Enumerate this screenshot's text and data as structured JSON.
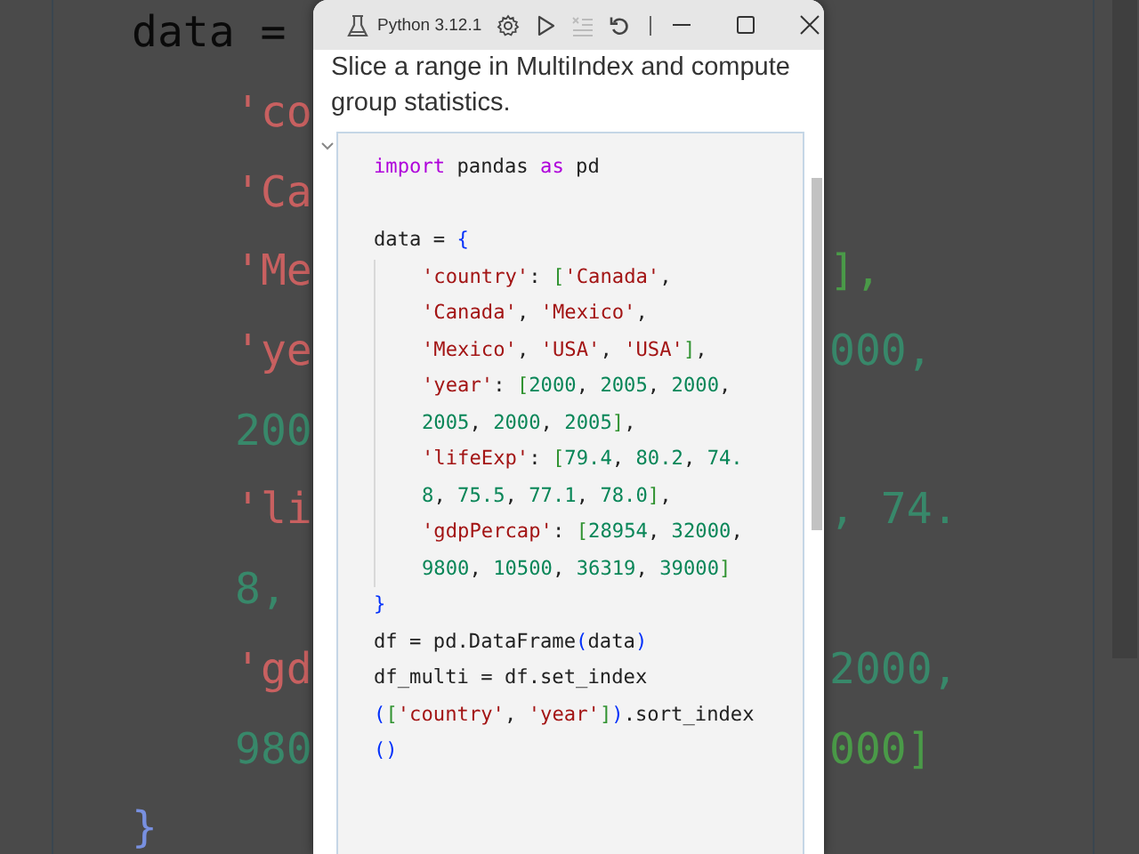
{
  "background_code": {
    "lines": [
      {
        "kind": "plain",
        "text": "data =",
        "children": [
          {
            "kind": "str",
            "text": "'co"
          },
          {
            "kind": "str",
            "text": "'Ca"
          },
          {
            "kind": "str",
            "text": "'Me",
            "right": {
              "kind": "bracket",
              "text": "],"
            }
          },
          {
            "kind": "str",
            "text": "'ye",
            "right": {
              "kind": "num",
              "text": "000,"
            }
          },
          {
            "kind": "num",
            "text": "200"
          },
          {
            "kind": "str",
            "text": "'li",
            "right": {
              "kind": "num",
              "text": ", 74."
            }
          },
          {
            "kind": "num",
            "text": "8,"
          },
          {
            "kind": "str",
            "text": "'gd",
            "right": {
              "kind": "num",
              "text": "2000,"
            }
          },
          {
            "kind": "num",
            "text": "980",
            "right": {
              "kind": "bracket",
              "text": "000]"
            }
          }
        ]
      },
      {
        "kind": "brace",
        "text": "}"
      }
    ]
  },
  "window": {
    "kernel": "Python 3.12.1",
    "toolbar": [
      {
        "kind": "settings",
        "disabled": false
      },
      {
        "kind": "run",
        "disabled": false
      },
      {
        "kind": "clear",
        "disabled": true
      },
      {
        "kind": "restart",
        "disabled": false
      }
    ],
    "description": "Slice a range in MultiIndex and compute group statistics.",
    "cell": {
      "expanded": true,
      "lines": [
        {
          "kind": "code",
          "tokens": [
            {
              "kind": "kw",
              "text": "import"
            },
            {
              "kind": "plain",
              "text": " pandas "
            },
            {
              "kind": "kw",
              "text": "as"
            },
            {
              "kind": "plain",
              "text": " pd"
            }
          ]
        },
        {
          "kind": "blank"
        },
        {
          "kind": "code",
          "tokens": [
            {
              "kind": "plain",
              "text": "data = "
            },
            {
              "kind": "brace",
              "text": "{"
            }
          ],
          "children": [
            {
              "kind": "code",
              "tokens": [
                {
                  "kind": "str",
                  "text": "'country'"
                },
                {
                  "kind": "plain",
                  "text": ": "
                },
                {
                  "kind": "bracket",
                  "text": "["
                },
                {
                  "kind": "str",
                  "text": "'Canada'"
                },
                {
                  "kind": "plain",
                  "text": ","
                }
              ]
            },
            {
              "kind": "code",
              "tokens": [
                {
                  "kind": "str",
                  "text": "'Canada'"
                },
                {
                  "kind": "plain",
                  "text": ", "
                },
                {
                  "kind": "str",
                  "text": "'Mexico'"
                },
                {
                  "kind": "plain",
                  "text": ","
                }
              ]
            },
            {
              "kind": "code",
              "tokens": [
                {
                  "kind": "str",
                  "text": "'Mexico'"
                },
                {
                  "kind": "plain",
                  "text": ", "
                },
                {
                  "kind": "str",
                  "text": "'USA'"
                },
                {
                  "kind": "plain",
                  "text": ", "
                },
                {
                  "kind": "str",
                  "text": "'USA'"
                },
                {
                  "kind": "bracket",
                  "text": "]"
                },
                {
                  "kind": "plain",
                  "text": ","
                }
              ]
            },
            {
              "kind": "code",
              "tokens": [
                {
                  "kind": "str",
                  "text": "'year'"
                },
                {
                  "kind": "plain",
                  "text": ": "
                },
                {
                  "kind": "bracket",
                  "text": "["
                },
                {
                  "kind": "num",
                  "text": "2000"
                },
                {
                  "kind": "plain",
                  "text": ", "
                },
                {
                  "kind": "num",
                  "text": "2005"
                },
                {
                  "kind": "plain",
                  "text": ", "
                },
                {
                  "kind": "num",
                  "text": "2000"
                },
                {
                  "kind": "plain",
                  "text": ","
                }
              ]
            },
            {
              "kind": "code",
              "tokens": [
                {
                  "kind": "num",
                  "text": "2005"
                },
                {
                  "kind": "plain",
                  "text": ", "
                },
                {
                  "kind": "num",
                  "text": "2000"
                },
                {
                  "kind": "plain",
                  "text": ", "
                },
                {
                  "kind": "num",
                  "text": "2005"
                },
                {
                  "kind": "bracket",
                  "text": "]"
                },
                {
                  "kind": "plain",
                  "text": ","
                }
              ]
            },
            {
              "kind": "code",
              "tokens": [
                {
                  "kind": "str",
                  "text": "'lifeExp'"
                },
                {
                  "kind": "plain",
                  "text": ": "
                },
                {
                  "kind": "bracket",
                  "text": "["
                },
                {
                  "kind": "num",
                  "text": "79.4"
                },
                {
                  "kind": "plain",
                  "text": ", "
                },
                {
                  "kind": "num",
                  "text": "80.2"
                },
                {
                  "kind": "plain",
                  "text": ", "
                },
                {
                  "kind": "num",
                  "text": "74."
                }
              ]
            },
            {
              "kind": "code",
              "tokens": [
                {
                  "kind": "num",
                  "text": "8"
                },
                {
                  "kind": "plain",
                  "text": ", "
                },
                {
                  "kind": "num",
                  "text": "75.5"
                },
                {
                  "kind": "plain",
                  "text": ", "
                },
                {
                  "kind": "num",
                  "text": "77.1"
                },
                {
                  "kind": "plain",
                  "text": ", "
                },
                {
                  "kind": "num",
                  "text": "78.0"
                },
                {
                  "kind": "bracket",
                  "text": "]"
                },
                {
                  "kind": "plain",
                  "text": ","
                }
              ]
            },
            {
              "kind": "code",
              "tokens": [
                {
                  "kind": "str",
                  "text": "'gdpPercap'"
                },
                {
                  "kind": "plain",
                  "text": ": "
                },
                {
                  "kind": "bracket",
                  "text": "["
                },
                {
                  "kind": "num",
                  "text": "28954"
                },
                {
                  "kind": "plain",
                  "text": ", "
                },
                {
                  "kind": "num",
                  "text": "32000"
                },
                {
                  "kind": "plain",
                  "text": ","
                }
              ]
            },
            {
              "kind": "code",
              "tokens": [
                {
                  "kind": "num",
                  "text": "9800"
                },
                {
                  "kind": "plain",
                  "text": ", "
                },
                {
                  "kind": "num",
                  "text": "10500"
                },
                {
                  "kind": "plain",
                  "text": ", "
                },
                {
                  "kind": "num",
                  "text": "36319"
                },
                {
                  "kind": "plain",
                  "text": ", "
                },
                {
                  "kind": "num",
                  "text": "39000"
                },
                {
                  "kind": "bracket",
                  "text": "]"
                }
              ]
            }
          ]
        },
        {
          "kind": "code",
          "tokens": [
            {
              "kind": "brace",
              "text": "}"
            }
          ]
        },
        {
          "kind": "code",
          "tokens": [
            {
              "kind": "plain",
              "text": "df = pd.DataFrame"
            },
            {
              "kind": "brace",
              "text": "("
            },
            {
              "kind": "plain",
              "text": "data"
            },
            {
              "kind": "brace",
              "text": ")"
            }
          ]
        },
        {
          "kind": "code",
          "tokens": [
            {
              "kind": "plain",
              "text": "df_multi = df.set_index"
            }
          ]
        },
        {
          "kind": "code",
          "tokens": [
            {
              "kind": "brace",
              "text": "("
            },
            {
              "kind": "bracket",
              "text": "["
            },
            {
              "kind": "str",
              "text": "'country'"
            },
            {
              "kind": "plain",
              "text": ", "
            },
            {
              "kind": "str",
              "text": "'year'"
            },
            {
              "kind": "bracket",
              "text": "]"
            },
            {
              "kind": "brace",
              "text": ")"
            },
            {
              "kind": "plain",
              "text": ".sort_index"
            }
          ]
        },
        {
          "kind": "code",
          "tokens": [
            {
              "kind": "brace",
              "text": "()"
            }
          ]
        }
      ]
    }
  }
}
